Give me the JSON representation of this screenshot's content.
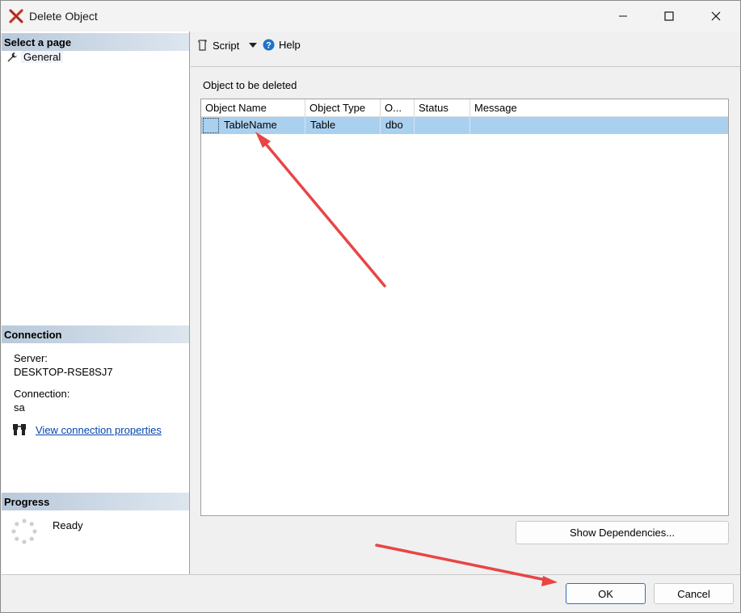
{
  "window": {
    "title": "Delete Object"
  },
  "left": {
    "select_page_header": "Select a page",
    "pages": [
      {
        "label": "General"
      }
    ],
    "connection_header": "Connection",
    "server_label": "Server:",
    "server_value": "DESKTOP-RSE8SJ7",
    "connection_label": "Connection:",
    "connection_value": "sa",
    "view_props_link": "View connection properties",
    "progress_header": "Progress",
    "progress_status": "Ready"
  },
  "toolbar": {
    "script_label": "Script",
    "help_label": "Help"
  },
  "main": {
    "section_label": "Object to be deleted",
    "columns": [
      "Object Name",
      "Object Type",
      "O...",
      "Status",
      "Message"
    ],
    "rows": [
      {
        "name": "TableName",
        "type": "Table",
        "owner": "dbo",
        "status": "",
        "message": ""
      }
    ],
    "show_dependencies_label": "Show Dependencies..."
  },
  "footer": {
    "ok_label": "OK",
    "cancel_label": "Cancel"
  },
  "colors": {
    "accent": "#2f6fbf",
    "selection": "#aad0f0",
    "annotation_arrow": "#e84545",
    "link": "#0645ad"
  }
}
